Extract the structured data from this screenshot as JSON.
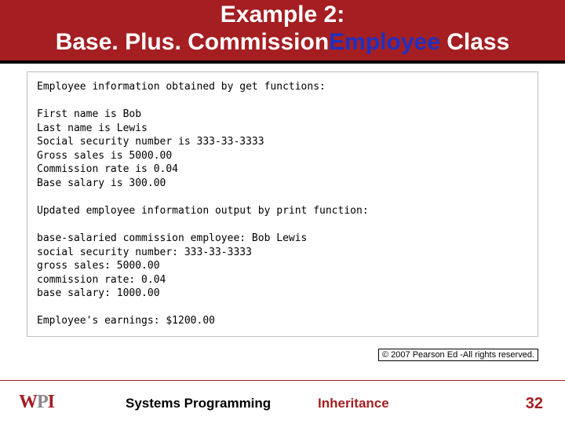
{
  "title": {
    "line1": "Example 2:",
    "line2_a": "Base. Plus. Commission",
    "line2_b": "Employee",
    "line2_c": " Class"
  },
  "output": {
    "h1": "Employee information obtained by get functions:",
    "b1l1": "First name is Bob",
    "b1l2": "Last name is Lewis",
    "b1l3": "Social security number is 333-33-3333",
    "b1l4": "Gross sales is 5000.00",
    "b1l5": "Commission rate is 0.04",
    "b1l6": "Base salary is 300.00",
    "h2": "Updated employee information output by print function:",
    "b2l1": "base-salaried commission employee: Bob Lewis",
    "b2l2": "social security number: 333-33-3333",
    "b2l3": "gross sales: 5000.00",
    "b2l4": "commission rate: 0.04",
    "b2l5": "base salary: 1000.00",
    "h3": "Employee's earnings: $1200.00"
  },
  "copyright": "© 2007 Pearson Ed -All rights reserved.",
  "footer": {
    "left": "Systems Programming",
    "center": "Inheritance",
    "page": "32"
  },
  "logo": {
    "w": "W",
    "p": "P",
    "i": "I"
  }
}
